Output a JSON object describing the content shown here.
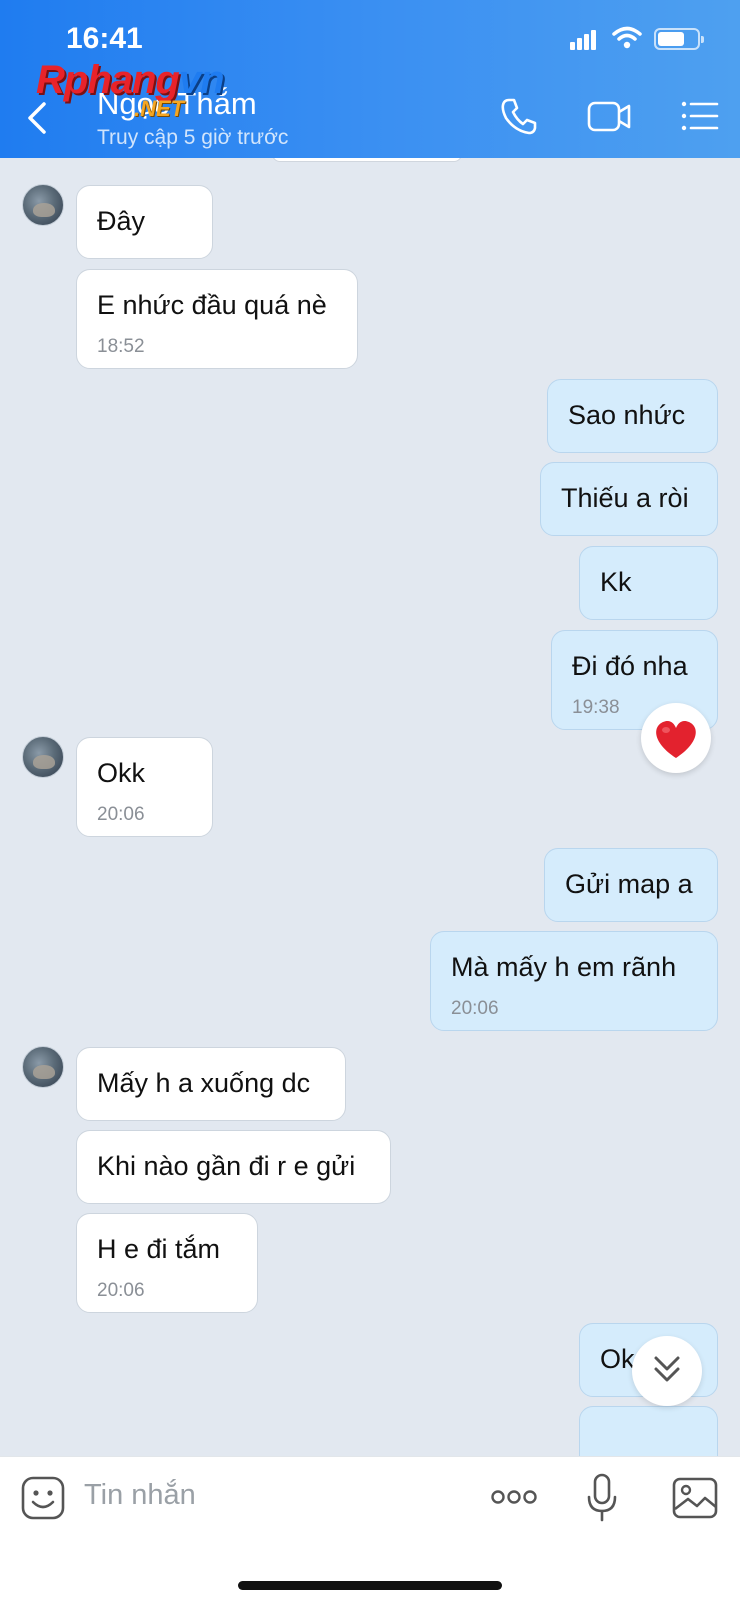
{
  "status_bar": {
    "time": "16:41"
  },
  "header": {
    "contact_name": "Ngọc Thắm",
    "contact_status": "Truy cập 5 giờ trước",
    "watermark_main_red": "Rphang",
    "watermark_main_blue": "vn",
    "watermark_net": ".NET",
    "icons": [
      "back-icon",
      "phone-icon",
      "video-call-icon",
      "menu-list-icon"
    ]
  },
  "messages": [
    {
      "dir": "in",
      "text": "Đây",
      "time": ""
    },
    {
      "dir": "in",
      "text": "E nhức đầu quá nè",
      "time": "18:52"
    },
    {
      "dir": "out",
      "text": "Sao nhức",
      "time": ""
    },
    {
      "dir": "out",
      "text": "Thiếu a ròi",
      "time": ""
    },
    {
      "dir": "out",
      "text": "Kk",
      "time": ""
    },
    {
      "dir": "out",
      "text": "Đi đó nha",
      "time": "19:38",
      "reaction": "heart"
    },
    {
      "dir": "in",
      "text": "Okk",
      "time": "20:06"
    },
    {
      "dir": "out",
      "text": "Gửi map a",
      "time": ""
    },
    {
      "dir": "out",
      "text": "Mà mấy h em rãnh",
      "time": "20:06"
    },
    {
      "dir": "in",
      "text": "Mấy h a xuống dc",
      "time": ""
    },
    {
      "dir": "in",
      "text": "Khi nào gần đi r e gửi",
      "time": ""
    },
    {
      "dir": "in",
      "text": "H e đi tắm",
      "time": "20:06"
    },
    {
      "dir": "out",
      "text": "Ok",
      "time": ""
    }
  ],
  "composer": {
    "placeholder": "Tin nhắn",
    "icons": [
      "sticker-icon",
      "more-icon",
      "microphone-icon",
      "image-icon"
    ]
  },
  "colors": {
    "header_start": "#1f7cf0",
    "header_end": "#4ea0f0",
    "chat_bg": "#e2e8f0",
    "outgoing_bubble": "#d5ecfc",
    "incoming_bubble": "#ffffff"
  }
}
